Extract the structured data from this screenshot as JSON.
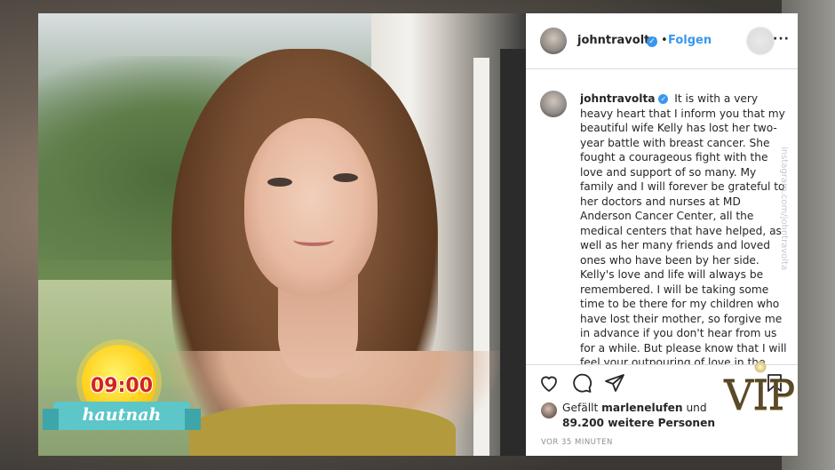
{
  "post": {
    "username": "johntravolta",
    "follow_separator": "•",
    "follow_label": "Folgen",
    "more_label": "···",
    "caption_username": "johntravolta",
    "caption_text": "It is with a very heavy heart that I inform you that my beautiful wife Kelly has lost her two-year battle with breast cancer. She fought a courageous fight with the love and support of so many.  My family and I will forever be grateful to her doctors and nurses at MD Anderson Cancer Center, all the medical centers that have helped, as well as her many friends and loved ones who have been by her side. Kelly's love and life will always be remembered. I will be taking some time to be there for my children who have lost their mother, so forgive me in advance if you don't hear from us for a while.  But please know that I will feel your outpouring of love in the weeks and months ahead as we heal.",
    "watermark": "instagram.com/johntravolta",
    "liked_prefix": "Gefällt",
    "liked_user": "marlenelufen",
    "liked_and": "und",
    "liked_count": "89.200 weitere Personen",
    "time_ago": "VOR 35 MINUTEN"
  },
  "icons": {
    "verified": "verified-check-icon",
    "like": "heart-icon",
    "comment": "comment-icon",
    "share": "paper-plane-icon",
    "save": "bookmark-icon"
  },
  "overlay": {
    "badge_time": "09:00",
    "badge_label": "hautnah",
    "vip_label": "VIP"
  },
  "colors": {
    "instagram_blue": "#3897f0",
    "badge_red": "#d2241e",
    "ribbon_teal": "#5cc6c8",
    "sun_yellow": "#ffd21e"
  }
}
